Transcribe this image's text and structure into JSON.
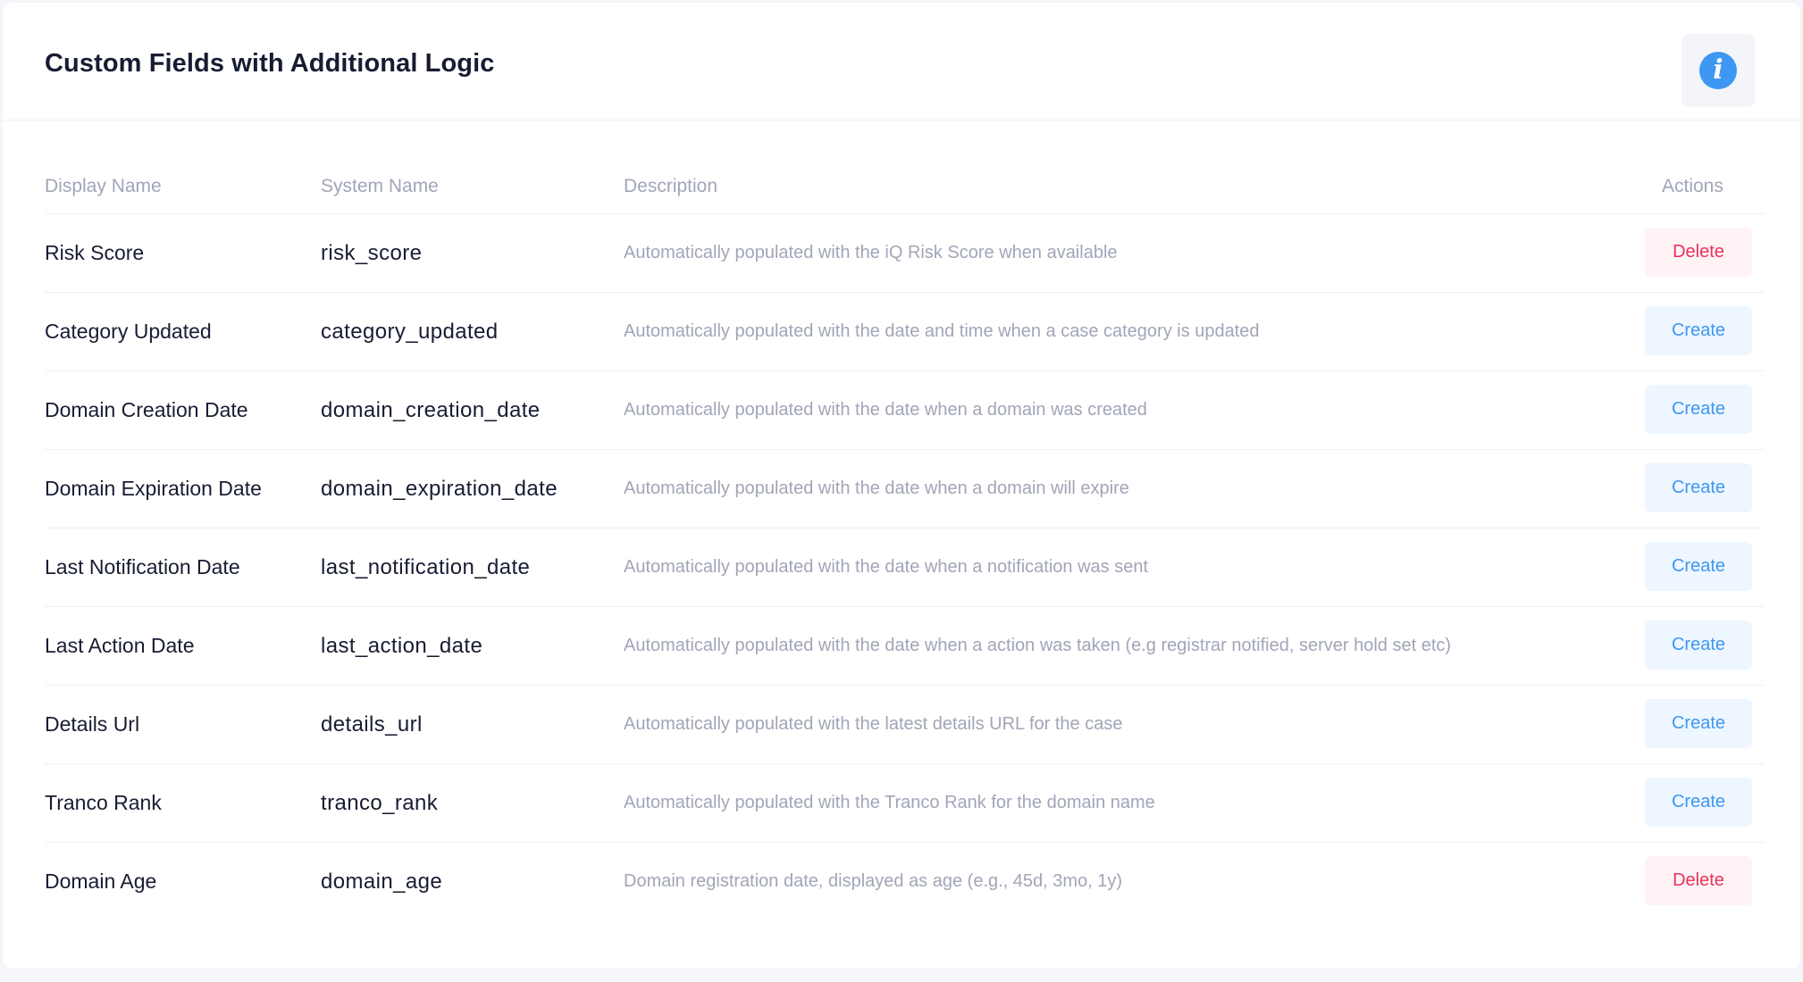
{
  "header": {
    "title": "Custom Fields with Additional Logic",
    "info_icon": "info-icon"
  },
  "table": {
    "columns": {
      "display_name": "Display Name",
      "system_name": "System Name",
      "description": "Description",
      "actions": "Actions"
    },
    "rows": [
      {
        "display": "Risk Score",
        "system": "risk_score",
        "description": "Automatically populated with the iQ Risk Score when available",
        "action": "Delete"
      },
      {
        "display": "Category Updated",
        "system": "category_updated",
        "description": "Automatically populated with the date and time when a case category is updated",
        "action": "Create"
      },
      {
        "display": "Domain Creation Date",
        "system": "domain_creation_date",
        "description": "Automatically populated with the date when a domain was created",
        "action": "Create"
      },
      {
        "display": "Domain Expiration Date",
        "system": "domain_expiration_date",
        "description": "Automatically populated with the date when a domain will expire",
        "action": "Create"
      },
      {
        "display": "Last Notification Date",
        "system": "last_notification_date",
        "description": "Automatically populated with the date when a notification was sent",
        "action": "Create"
      },
      {
        "display": "Last Action Date",
        "system": "last_action_date",
        "description": "Automatically populated with the date when a action was taken (e.g registrar notified, server hold set etc)",
        "action": "Create"
      },
      {
        "display": "Details Url",
        "system": "details_url",
        "description": "Automatically populated with the latest details URL for the case",
        "action": "Create"
      },
      {
        "display": "Tranco Rank",
        "system": "tranco_rank",
        "description": "Automatically populated with the Tranco Rank for the domain name",
        "action": "Create"
      },
      {
        "display": "Domain Age",
        "system": "domain_age",
        "description": "Domain registration date, displayed as age (e.g., 45d, 3mo, 1y)",
        "action": "Delete"
      }
    ]
  },
  "colors": {
    "primary": "#3e97f2",
    "danger": "#e8325a",
    "text_dark": "#181c32",
    "text_muted": "#a1a5b7"
  }
}
